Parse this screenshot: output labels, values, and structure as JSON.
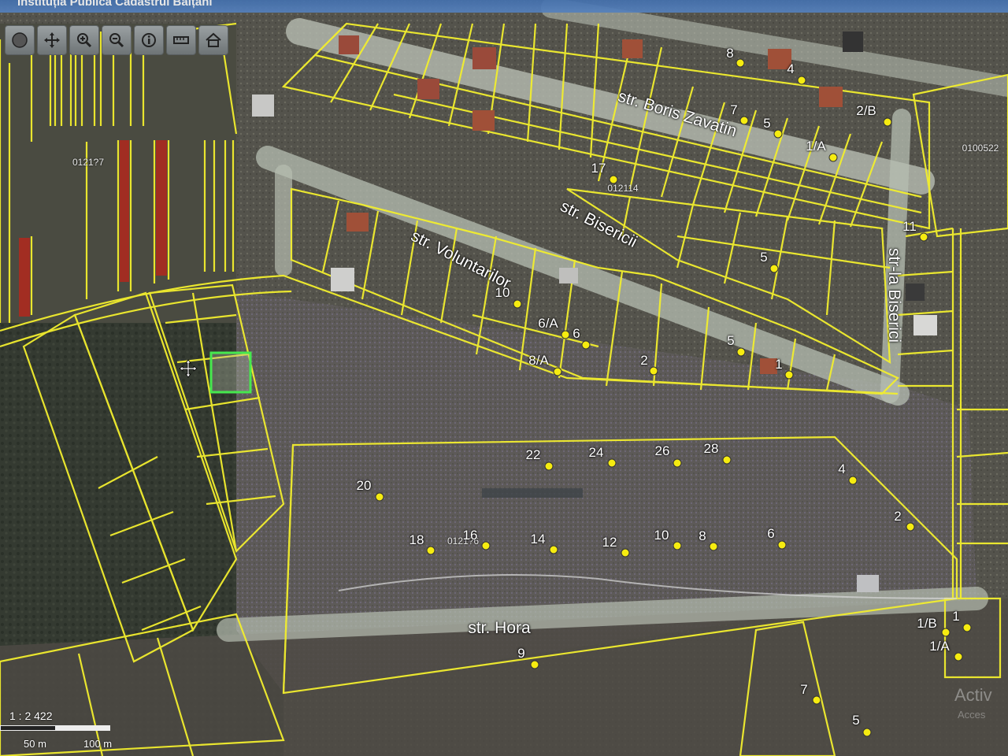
{
  "title": "Instituția Publică Cadastrul Bălțani",
  "colors": {
    "parcel_line": "#f2ee2e",
    "selected_parcel": "#46e84e",
    "highlight_parcel": "#b1281d",
    "address_dot": "#f6ec10",
    "road": "#bcc2b8"
  },
  "toolbar": {
    "buttons": [
      {
        "name": "globe-button",
        "icon": "globe-icon"
      },
      {
        "name": "pan-button",
        "icon": "move-arrows-icon"
      },
      {
        "name": "zoom-in-button",
        "icon": "zoom-in-icon"
      },
      {
        "name": "zoom-out-button",
        "icon": "zoom-out-icon"
      },
      {
        "name": "info-button",
        "icon": "info-icon"
      },
      {
        "name": "measure-button",
        "icon": "ruler-icon"
      },
      {
        "name": "home-button",
        "icon": "home-icon"
      }
    ]
  },
  "streets": [
    {
      "id": "str-boris-zavatin",
      "label": "str. Boris Zavatin"
    },
    {
      "id": "str-bisericii",
      "label": "str. Bisericii"
    },
    {
      "id": "str-voluntarilor",
      "label": "str. Voluntarilor"
    },
    {
      "id": "str-la-biserici",
      "label": "str-la Biserici"
    },
    {
      "id": "str-hora",
      "label": "str. Hora"
    }
  ],
  "cadastral_zones": [
    "0121?7",
    "012114",
    "0100522",
    "0121?6"
  ],
  "address_points": [
    {
      "label": "8"
    },
    {
      "label": "4"
    },
    {
      "label": "7"
    },
    {
      "label": "5"
    },
    {
      "label": "2/B"
    },
    {
      "label": "1/A"
    },
    {
      "label": "17"
    },
    {
      "label": "11"
    },
    {
      "label": "5"
    },
    {
      "label": "10"
    },
    {
      "label": "6/A"
    },
    {
      "label": "6"
    },
    {
      "label": "8/A"
    },
    {
      "label": "2"
    },
    {
      "label": "5"
    },
    {
      "label": "1"
    },
    {
      "label": "22"
    },
    {
      "label": "24"
    },
    {
      "label": "26"
    },
    {
      "label": "28"
    },
    {
      "label": "4"
    },
    {
      "label": "20"
    },
    {
      "label": "2"
    },
    {
      "label": "18"
    },
    {
      "label": "16"
    },
    {
      "label": "14"
    },
    {
      "label": "12"
    },
    {
      "label": "10"
    },
    {
      "label": "8"
    },
    {
      "label": "6"
    },
    {
      "label": "9"
    },
    {
      "label": "1/B"
    },
    {
      "label": "1"
    },
    {
      "label": "1/A"
    },
    {
      "label": "7"
    },
    {
      "label": "5"
    }
  ],
  "scale": {
    "ratio": "1 : 2 422",
    "tick_1": "50 m",
    "tick_2": "100 m"
  },
  "watermark": {
    "line1": "Activ",
    "line2": "Acces"
  }
}
